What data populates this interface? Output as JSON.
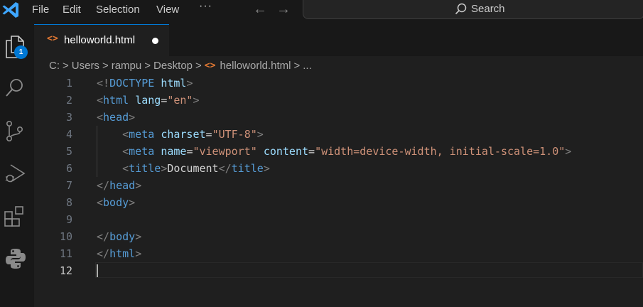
{
  "menu": {
    "file": "File",
    "edit": "Edit",
    "selection": "Selection",
    "view": "View",
    "more": "···"
  },
  "nav": {
    "back": "←",
    "forward": "→"
  },
  "search": {
    "label": "Search"
  },
  "activity": {
    "explorer_badge": "1"
  },
  "tab": {
    "icon": "<>",
    "label": "helloworld.html"
  },
  "breadcrumb": {
    "items": [
      "C:",
      "Users",
      "rampu",
      "Desktop",
      "helloworld.html",
      "..."
    ],
    "separator": ">",
    "file_icon": "<>"
  },
  "editor": {
    "active_line": 12,
    "lines": [
      {
        "num": "1"
      },
      {
        "num": "2"
      },
      {
        "num": "3"
      },
      {
        "num": "4"
      },
      {
        "num": "5"
      },
      {
        "num": "6"
      },
      {
        "num": "7"
      },
      {
        "num": "8"
      },
      {
        "num": "9"
      },
      {
        "num": "10"
      },
      {
        "num": "11"
      },
      {
        "num": "12"
      }
    ]
  },
  "colors": {
    "tag_bracket": "#808080",
    "tag_name": "#569cd6",
    "attr_name": "#9cdcfe",
    "attr_value": "#ce9178",
    "text": "#d4d4d4",
    "accent": "#0078d4",
    "html_icon": "#e37933"
  }
}
